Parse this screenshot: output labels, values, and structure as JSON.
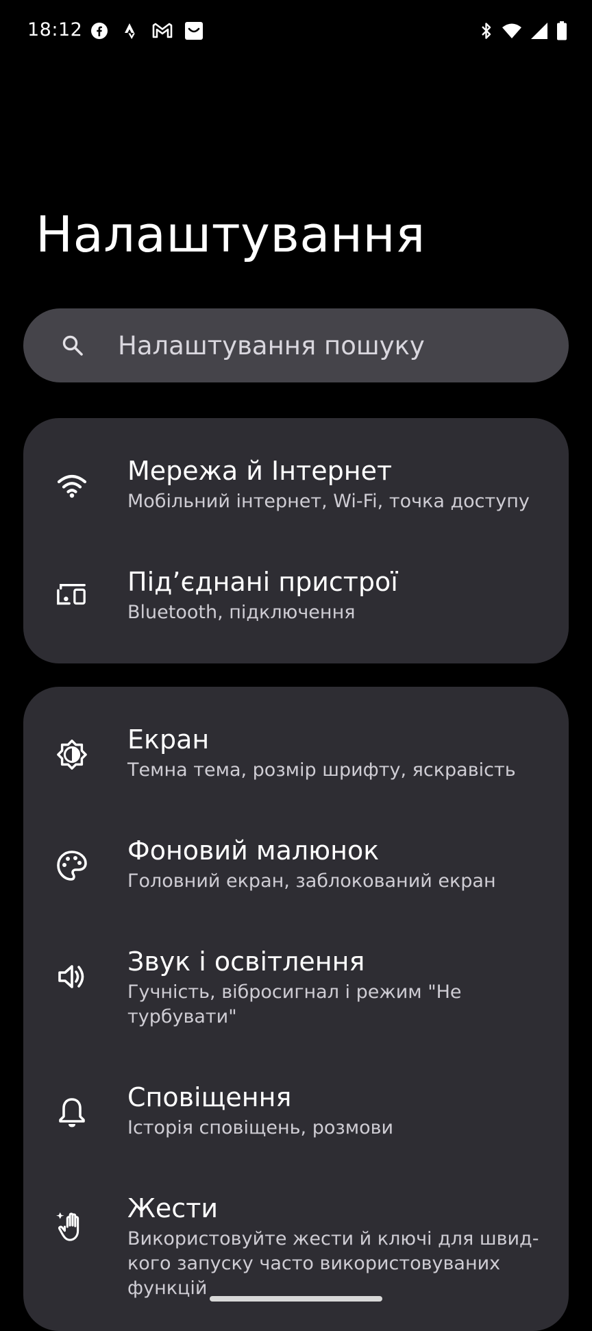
{
  "status_bar": {
    "time": "18:12",
    "notification_icons": [
      "facebook-icon",
      "strava-icon",
      "gmail-icon",
      "inbox-icon"
    ],
    "system_icons": [
      "bluetooth-icon",
      "wifi-icon",
      "cell-signal-icon",
      "battery-icon"
    ]
  },
  "page": {
    "title": "Налаштування"
  },
  "search": {
    "placeholder": "Налаштування пошуку"
  },
  "groups": [
    {
      "items": [
        {
          "icon": "wifi-icon",
          "title": "Мережа й Інтернет",
          "subtitle": "Мобільний інтернет, Wi‑Fi, точка доступу"
        },
        {
          "icon": "connected-devices-icon",
          "title": "Під’єднані пристрої",
          "subtitle": "Bluetooth, підключення"
        }
      ]
    },
    {
      "items": [
        {
          "icon": "brightness-icon",
          "title": "Екран",
          "subtitle": "Темна тема, розмір шрифту, яскравість"
        },
        {
          "icon": "palette-icon",
          "title": "Фоновий малюнок",
          "subtitle": "Головний екран, заблокований екран"
        },
        {
          "icon": "volume-icon",
          "title": "Звук і освітлення",
          "subtitle": "Гучність, вібросигнал і режим \"Не турбувати\""
        },
        {
          "icon": "bell-icon",
          "title": "Сповіщення",
          "subtitle": "Історія сповіщень, розмови"
        },
        {
          "icon": "gesture-hand-icon",
          "title": "Жести",
          "subtitle": "Використовуйте жести й ключі для швид-кого запуску часто використовуваних функцій"
        }
      ]
    }
  ]
}
